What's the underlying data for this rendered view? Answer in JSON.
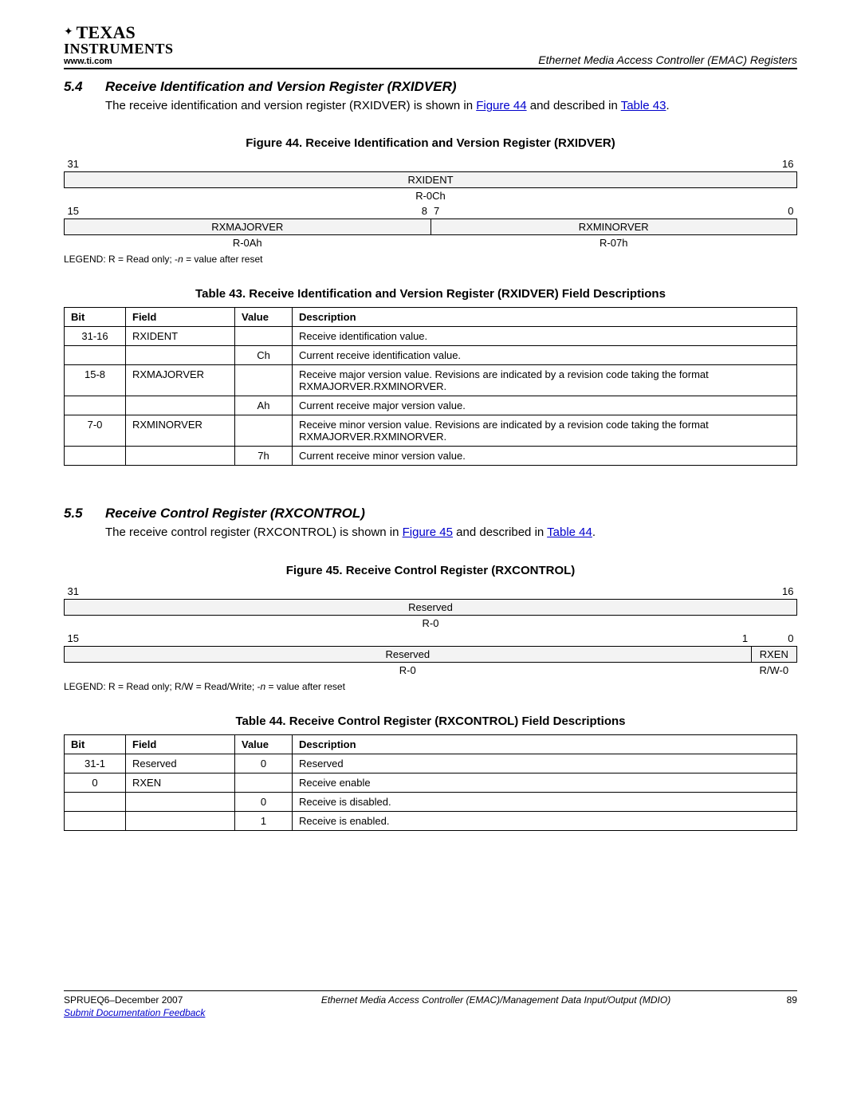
{
  "header": {
    "logo_top": "TEXAS",
    "logo_bottom": "INSTRUMENTS",
    "url": "www.ti.com",
    "right": "Ethernet Media Access Controller (EMAC) Registers"
  },
  "sec54": {
    "num": "5.4",
    "title": "Receive Identification and Version Register (RXIDVER)",
    "body_a": "The receive identification and version register (RXIDVER) is shown in ",
    "fig_link": "Figure 44",
    "body_b": " and described in ",
    "tbl_link": "Table 43",
    "body_c": "."
  },
  "fig44": {
    "title": "Figure 44. Receive Identification and Version Register (RXIDVER)",
    "bit_hi_l": "31",
    "bit_hi_r": "16",
    "row1_field": "RXIDENT",
    "row1_reset": "R-0Ch",
    "bit_lo_l": "15",
    "bit_lo_m1": "8",
    "bit_lo_m2": "7",
    "bit_lo_r": "0",
    "row2_field_l": "RXMAJORVER",
    "row2_field_r": "RXMINORVER",
    "row2_reset_l": "R-0Ah",
    "row2_reset_r": "R-07h",
    "legend": "LEGEND: R = Read only; -n = value after reset"
  },
  "tbl43": {
    "title": "Table 43. Receive Identification and Version Register (RXIDVER) Field Descriptions",
    "hdr_bit": "Bit",
    "hdr_field": "Field",
    "hdr_value": "Value",
    "hdr_desc": "Description",
    "rows": [
      {
        "bit": "31-16",
        "field": "RXIDENT",
        "value": "",
        "desc": "Receive identification value."
      },
      {
        "bit": "",
        "field": "",
        "value": "Ch",
        "desc": "Current receive identification value."
      },
      {
        "bit": "15-8",
        "field": "RXMAJORVER",
        "value": "",
        "desc": "Receive major version value. Revisions are indicated by a revision code taking the format RXMAJORVER.RXMINORVER."
      },
      {
        "bit": "",
        "field": "",
        "value": "Ah",
        "desc": "Current receive major version value."
      },
      {
        "bit": "7-0",
        "field": "RXMINORVER",
        "value": "",
        "desc": "Receive minor version value. Revisions are indicated by a revision code taking the format RXMAJORVER.RXMINORVER."
      },
      {
        "bit": "",
        "field": "",
        "value": "7h",
        "desc": "Current receive minor version value."
      }
    ]
  },
  "sec55": {
    "num": "5.5",
    "title": "Receive Control Register (RXCONTROL)",
    "body_a": "The receive control register (RXCONTROL) is shown in ",
    "fig_link": "Figure 45",
    "body_b": " and described in ",
    "tbl_link": "Table 44",
    "body_c": "."
  },
  "fig45": {
    "title": "Figure 45. Receive Control Register (RXCONTROL)",
    "bit_hi_l": "31",
    "bit_hi_r": "16",
    "row1_field": "Reserved",
    "row1_reset": "R-0",
    "bit_lo_l": "15",
    "bit_lo_m": "1",
    "bit_lo_r": "0",
    "row2_field_l": "Reserved",
    "row2_field_r": "RXEN",
    "row2_reset_l": "R-0",
    "row2_reset_r": "R/W-0",
    "legend": "LEGEND: R = Read only; R/W = Read/Write; -n = value after reset"
  },
  "tbl44": {
    "title": "Table 44. Receive Control Register (RXCONTROL) Field Descriptions",
    "hdr_bit": "Bit",
    "hdr_field": "Field",
    "hdr_value": "Value",
    "hdr_desc": "Description",
    "rows": [
      {
        "bit": "31-1",
        "field": "Reserved",
        "value": "0",
        "desc": "Reserved"
      },
      {
        "bit": "0",
        "field": "RXEN",
        "value": "",
        "desc": "Receive enable"
      },
      {
        "bit": "",
        "field": "",
        "value": "0",
        "desc": "Receive is disabled."
      },
      {
        "bit": "",
        "field": "",
        "value": "1",
        "desc": "Receive is enabled."
      }
    ]
  },
  "footer": {
    "docnum": "SPRUEQ6–December 2007",
    "center": "Ethernet Media Access Controller (EMAC)/Management Data Input/Output (MDIO)",
    "page": "89",
    "feedback": "Submit Documentation Feedback"
  }
}
